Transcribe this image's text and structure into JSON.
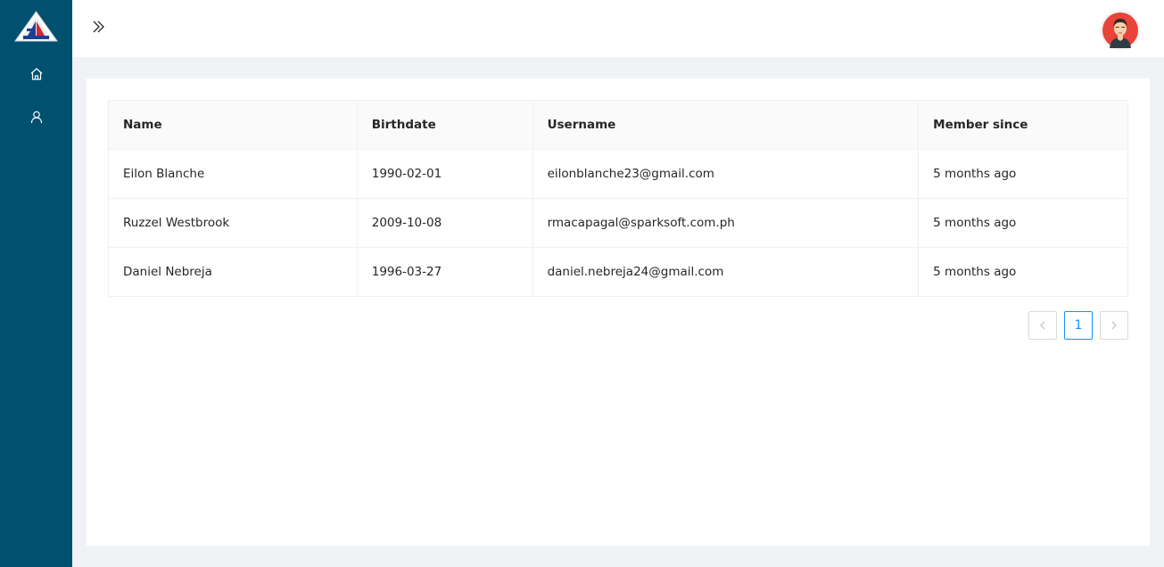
{
  "sidebar": {
    "logo_icon": "triangle-logo-icon",
    "items": [
      {
        "name": "home",
        "icon": "home-icon"
      },
      {
        "name": "user",
        "icon": "user-icon"
      }
    ]
  },
  "header": {
    "expand_icon": "double-chevron-right-icon",
    "avatar_icon": "user-avatar"
  },
  "table": {
    "columns": [
      "Name",
      "Birthdate",
      "Username",
      "Member since"
    ],
    "rows": [
      {
        "name": "Eilon Blanche",
        "birthdate": "1990-02-01",
        "username": "eilonblanche23@gmail.com",
        "member_since": "5 months ago"
      },
      {
        "name": "Ruzzel Westbrook",
        "birthdate": "2009-10-08",
        "username": "rmacapagal@sparksoft.com.ph",
        "member_since": "5 months ago"
      },
      {
        "name": "Daniel Nebreja",
        "birthdate": "1996-03-27",
        "username": "daniel.nebreja24@gmail.com",
        "member_since": "5 months ago"
      }
    ]
  },
  "pagination": {
    "current_page": "1",
    "prev_icon": "chevron-left-icon",
    "next_icon": "chevron-right-icon"
  },
  "colors": {
    "sidebar": "#00506f",
    "background": "#f0f2f5",
    "accent": "#1890ff",
    "avatar_bg": "#e8443a"
  }
}
